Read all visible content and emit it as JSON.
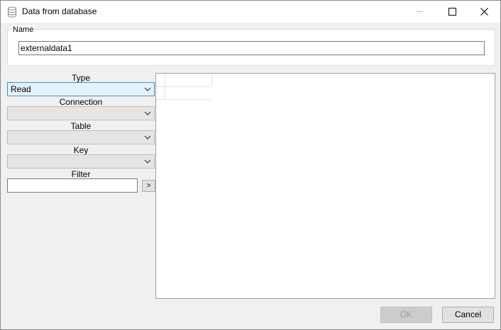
{
  "window": {
    "title": "Data from database"
  },
  "name_group": {
    "legend": "Name",
    "value": "externaldata1"
  },
  "fields": {
    "type_label": "Type",
    "type_value": "Read",
    "connection_label": "Connection",
    "connection_value": "",
    "table_label": "Table",
    "table_value": "",
    "key_label": "Key",
    "key_value": "",
    "filter_label": "Filter",
    "filter_value": "",
    "filter_button": ">"
  },
  "buttons": {
    "ok": "OK",
    "cancel": "Cancel"
  }
}
